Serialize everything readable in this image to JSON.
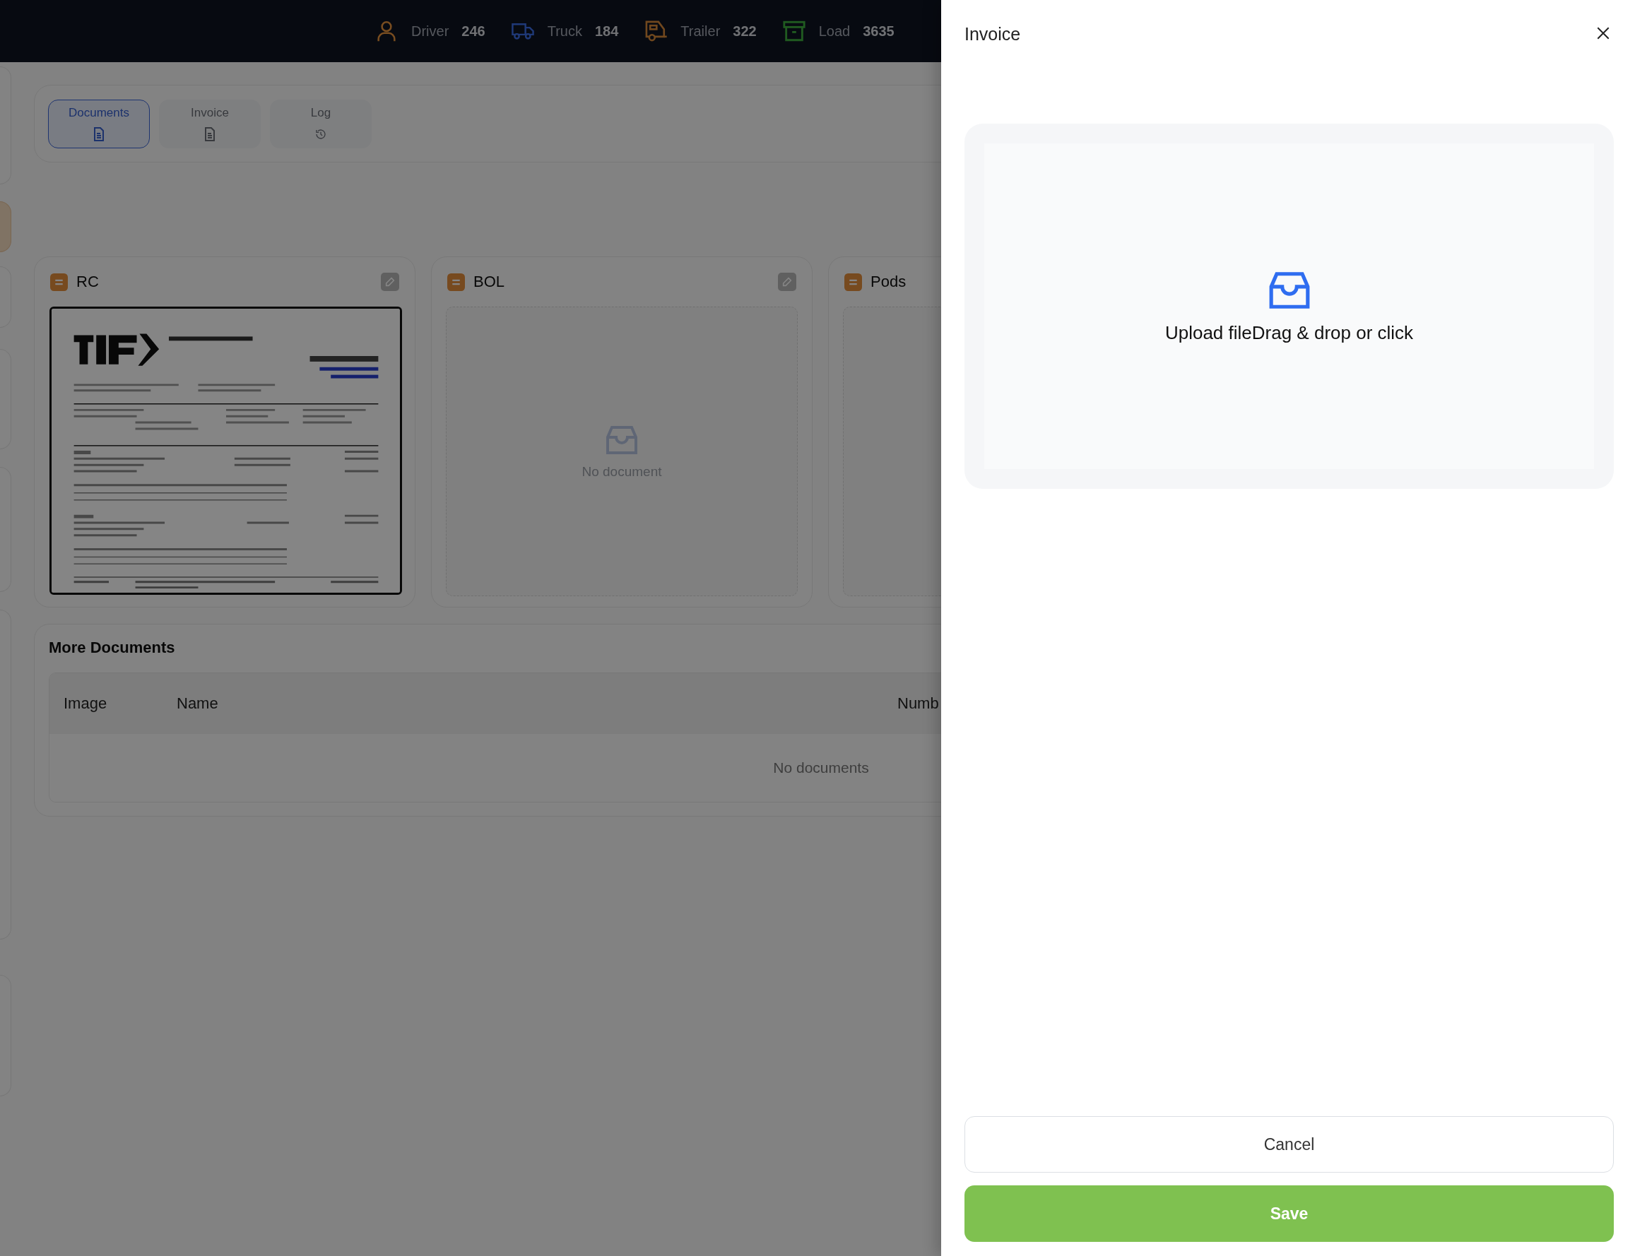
{
  "top_bar": {
    "stats": [
      {
        "kind": "driver",
        "label": "Driver",
        "count": "246"
      },
      {
        "kind": "truck",
        "label": "Truck",
        "count": "184"
      },
      {
        "kind": "trailer",
        "label": "Trailer",
        "count": "322"
      },
      {
        "kind": "load",
        "label": "Load",
        "count": "3635"
      }
    ]
  },
  "tabs": [
    {
      "label": "Documents",
      "selected": true
    },
    {
      "label": "Invoice",
      "selected": false
    },
    {
      "label": "Log",
      "selected": false
    }
  ],
  "document_cards": [
    {
      "title": "RC",
      "editable": true
    },
    {
      "title": "BOL",
      "editable": true,
      "empty_text": "No document"
    },
    {
      "title": "Pods"
    }
  ],
  "more_documents": {
    "title": "More Documents",
    "table": {
      "columns": [
        "Image",
        "Name",
        "Numb"
      ],
      "empty_text": "No documents"
    }
  },
  "drawer": {
    "title": "Invoice",
    "upload": {
      "text": "Upload fileDrag & drop or click"
    },
    "buttons": [
      {
        "label": "Cancel",
        "kind": "secondary"
      },
      {
        "label": "Save",
        "kind": "primary"
      }
    ]
  }
}
